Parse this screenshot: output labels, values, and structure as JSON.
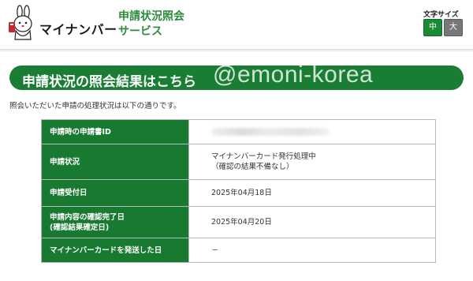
{
  "header": {
    "logo_text": "マイナンバー",
    "service_title_line1": "申請状況照会",
    "service_title_line2": "サービス",
    "font_size_label": "文字サイズ",
    "font_size_medium": "中",
    "font_size_large": "大"
  },
  "banner": {
    "title": "申請状況の照会結果はこちら",
    "watermark": "@emoni-korea"
  },
  "intro_text": "照会いただいた申請の処理状況は以下の通りです。",
  "table": {
    "rows": [
      {
        "label": "申請時の申請書ID",
        "value": ""
      },
      {
        "label": "申請状況",
        "value_line1": "マイナンバーカード発行処理中",
        "value_line2": "（確認の結果不備なし）"
      },
      {
        "label": "申請受付日",
        "value": "2025年04月18日"
      },
      {
        "label_line1": "申請内容の確認完了日",
        "label_line2": "(確認結果確定日)",
        "value": "2025年04月20日"
      },
      {
        "label": "マイナンバーカードを発送した日",
        "value": "－"
      }
    ]
  },
  "colors": {
    "brand_green": "#1a7d34",
    "title_green": "#2c8a3c",
    "mascot_red": "#c4262e"
  },
  "icons": {
    "mascot": "mynaporn-rabbit-mascot"
  }
}
